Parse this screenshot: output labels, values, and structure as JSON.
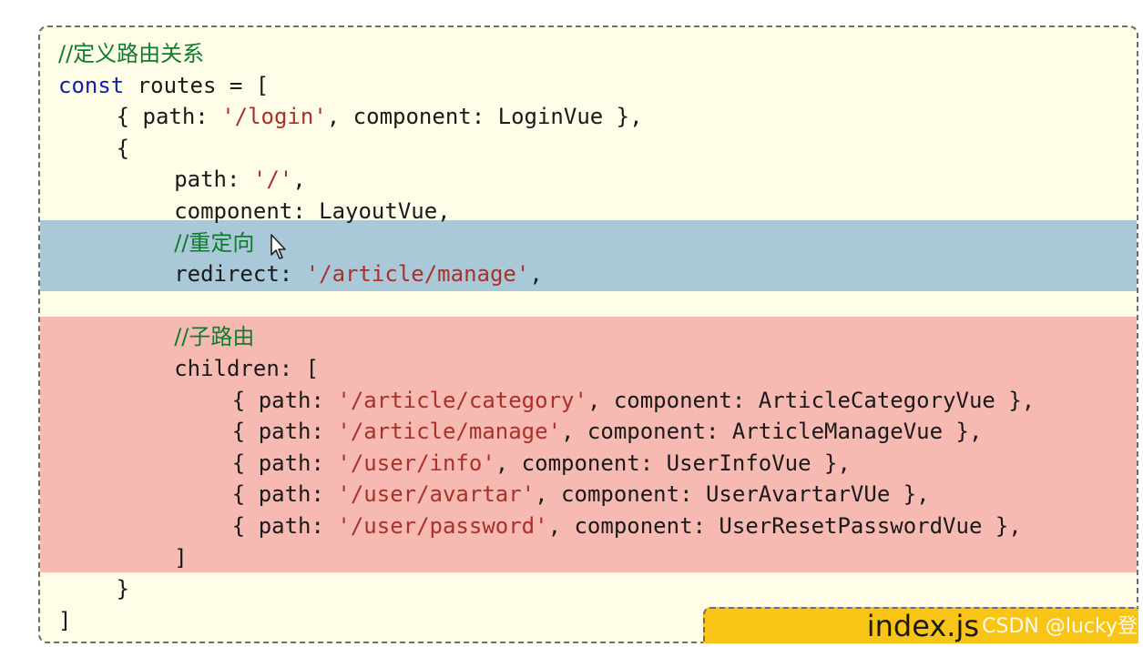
{
  "code": {
    "lines": [
      {
        "indent": 0,
        "parts": [
          {
            "t": "//定义路由关系",
            "c": "cm"
          }
        ]
      },
      {
        "indent": 0,
        "parts": [
          {
            "t": "const",
            "c": "kw"
          },
          {
            "t": " routes = ["
          }
        ]
      },
      {
        "indent": 4,
        "parts": [
          {
            "t": "{ path: "
          },
          {
            "t": "'/login'",
            "c": "st"
          },
          {
            "t": ", component: LoginVue },"
          }
        ]
      },
      {
        "indent": 4,
        "parts": [
          {
            "t": "{"
          }
        ]
      },
      {
        "indent": 8,
        "parts": [
          {
            "t": "path: "
          },
          {
            "t": "'/'",
            "c": "st"
          },
          {
            "t": ","
          }
        ]
      },
      {
        "indent": 8,
        "parts": [
          {
            "t": "component: LayoutVue,"
          }
        ]
      },
      {
        "indent": 8,
        "parts": [
          {
            "t": "//重定向",
            "c": "cm"
          }
        ]
      },
      {
        "indent": 8,
        "parts": [
          {
            "t": "redirect: "
          },
          {
            "t": "'/article/manage'",
            "c": "st"
          },
          {
            "t": ","
          }
        ]
      },
      {
        "indent": 0,
        "parts": []
      },
      {
        "indent": 8,
        "parts": [
          {
            "t": "//子路由",
            "c": "cm"
          }
        ]
      },
      {
        "indent": 8,
        "parts": [
          {
            "t": "children: ["
          }
        ]
      },
      {
        "indent": 12,
        "parts": [
          {
            "t": "{ path: "
          },
          {
            "t": "'/article/category'",
            "c": "st"
          },
          {
            "t": ", component: ArticleCategoryVue },"
          }
        ]
      },
      {
        "indent": 12,
        "parts": [
          {
            "t": "{ path: "
          },
          {
            "t": "'/article/manage'",
            "c": "st"
          },
          {
            "t": ", component: ArticleManageVue },"
          }
        ]
      },
      {
        "indent": 12,
        "parts": [
          {
            "t": "{ path: "
          },
          {
            "t": "'/user/info'",
            "c": "st"
          },
          {
            "t": ", component: UserInfoVue },"
          }
        ]
      },
      {
        "indent": 12,
        "parts": [
          {
            "t": "{ path: "
          },
          {
            "t": "'/user/avartar'",
            "c": "st"
          },
          {
            "t": ", component: UserAvartarVUe },"
          }
        ]
      },
      {
        "indent": 12,
        "parts": [
          {
            "t": "{ path: "
          },
          {
            "t": "'/user/password'",
            "c": "st"
          },
          {
            "t": ", component: UserResetPasswordVue },"
          }
        ]
      },
      {
        "indent": 8,
        "parts": [
          {
            "t": "]"
          }
        ]
      },
      {
        "indent": 4,
        "parts": [
          {
            "t": "}"
          }
        ]
      },
      {
        "indent": 0,
        "parts": [
          {
            "t": "]"
          }
        ]
      }
    ]
  },
  "file_tab": {
    "label": "index.js"
  },
  "watermark": "CSDN @lucky登",
  "colors": {
    "panel_bg": "#fffde8",
    "redirect_highlight": "#a9c9d8",
    "children_highlight": "#f6bab3",
    "tab_bg": "#f8c516",
    "comment": "#0e7c2c",
    "keyword": "#1020a8",
    "string": "#a8312a"
  },
  "icons": {
    "cursor": "mouse-pointer-icon"
  }
}
